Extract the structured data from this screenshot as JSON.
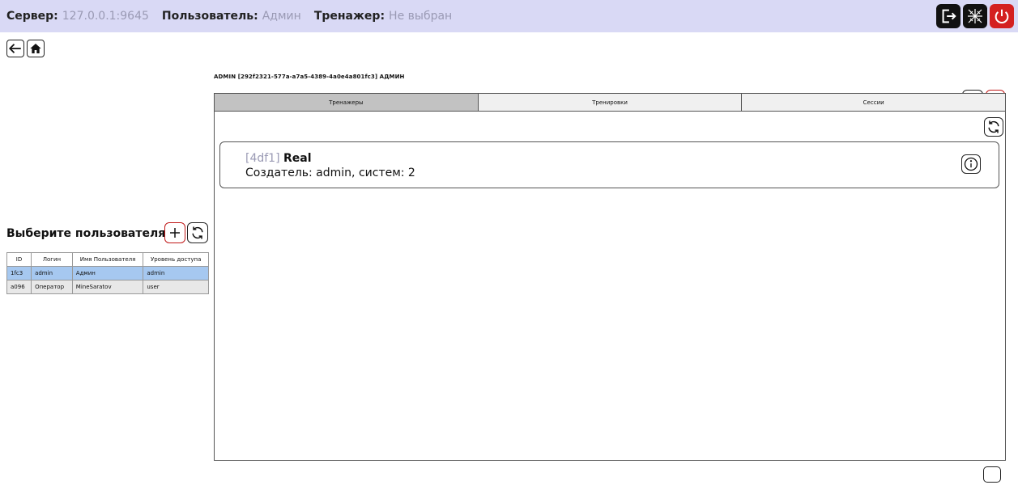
{
  "topbar": {
    "server_label": "Сервер:",
    "server_value": "127.0.0.1:9645",
    "user_label": "Пользователь:",
    "user_value": "Админ",
    "trainer_label": "Тренажер:",
    "trainer_value": "Не выбран"
  },
  "header": {
    "user_info": "ADMIN [292f2321-577a-a7a5-4389-4a0e4a801fc3] АДМИН"
  },
  "tabs": [
    {
      "label": "Тренажеры",
      "active": true
    },
    {
      "label": "Тренировки",
      "active": false
    },
    {
      "label": "Сессии",
      "active": false
    }
  ],
  "trainer_card": {
    "id": "[4df1]",
    "name": "Real",
    "details": "Создатель: admin, систем: 2"
  },
  "users": {
    "title": "Выберите пользователя:",
    "columns": [
      "ID",
      "Логин",
      "Имя Пользователя",
      "Уровень доступа"
    ],
    "rows": [
      {
        "id": "1fc3",
        "login": "admin",
        "name": "Админ",
        "level": "admin",
        "selected": true
      },
      {
        "id": "a096",
        "login": "Оператор",
        "name": "MineSaratov",
        "level": "user",
        "selected": false
      }
    ]
  },
  "colors": {
    "topbar_bg": "#d9d9f5",
    "muted_text": "#9a9ab4",
    "danger": "#d42020",
    "selected_row": "#a6c8f0"
  },
  "icons": [
    "logout-icon",
    "network-icon",
    "power-icon",
    "back-arrow-icon",
    "home-icon",
    "edit-icon",
    "trash-icon",
    "refresh-icon",
    "info-icon",
    "plus-icon",
    "moon-icon"
  ]
}
